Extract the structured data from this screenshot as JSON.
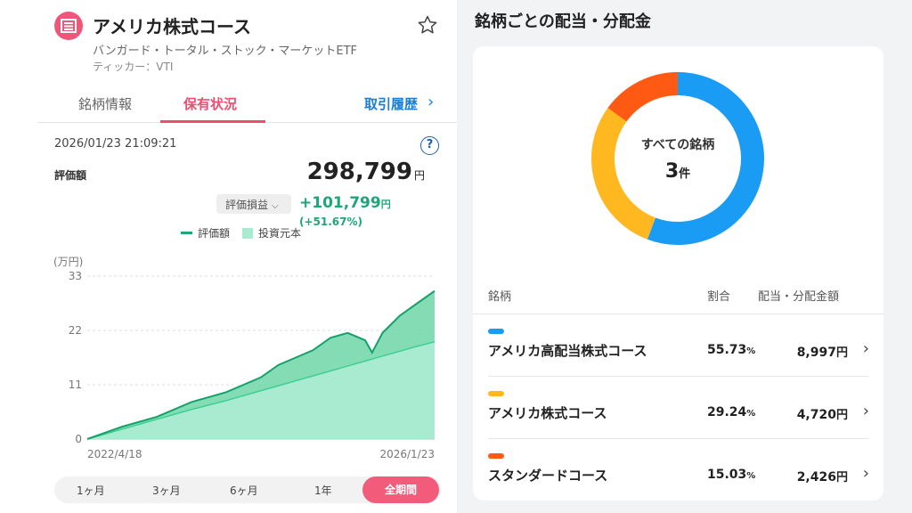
{
  "header": {
    "title": "アメリカ株式コース",
    "subtitle": "バンガード・トータル・ストック・マーケットETF",
    "ticker": "ティッカー：VTI"
  },
  "tabs": [
    {
      "label": "銘柄情報"
    },
    {
      "label": "保有状況",
      "active": true
    },
    {
      "label": "取引履歴"
    }
  ],
  "summary": {
    "datetime": "2026/01/23 21:09:21",
    "valuation_label": "評価額",
    "valuation_value": "298,799",
    "yen": "円",
    "pl_dropdown_label": "評価損益",
    "pl_value": "+101,799",
    "pl_pct": "(+51.67%)"
  },
  "chart_data": {
    "type": "area",
    "unit_label": "(万円)",
    "series": [
      {
        "name": "評価額",
        "color": "#1ea776"
      },
      {
        "name": "投資元本",
        "color": "#a9ebd0"
      }
    ],
    "ylim": [
      0,
      33
    ],
    "yticks": [
      "0",
      "11",
      "22",
      "33"
    ],
    "x_start_label": "2022/4/18",
    "x_end_label": "2026/1/23",
    "x": [
      0,
      0.1,
      0.2,
      0.3,
      0.4,
      0.5,
      0.55,
      0.6,
      0.65,
      0.7,
      0.75,
      0.8,
      0.82,
      0.85,
      0.9,
      0.95,
      1.0
    ],
    "valuation": [
      0,
      2.5,
      4.5,
      7.5,
      9.5,
      12.5,
      15,
      16.5,
      18,
      20.5,
      21.5,
      20,
      17.5,
      21.5,
      25,
      27.5,
      30.0
    ],
    "principal": [
      0,
      2,
      4,
      6,
      7.8,
      9.8,
      10.8,
      11.8,
      12.8,
      13.8,
      14.8,
      15.8,
      16.2,
      16.8,
      17.8,
      18.8,
      19.7
    ]
  },
  "periods": [
    {
      "label": "1ヶ月"
    },
    {
      "label": "3ヶ月"
    },
    {
      "label": "6ヶ月"
    },
    {
      "label": "1年"
    },
    {
      "label": "全期間",
      "active": true
    }
  ],
  "dividends": {
    "title": "銘柄ごとの配当・分配金",
    "donut_label": "すべての銘柄",
    "count": "3",
    "count_unit": "件",
    "columns": {
      "name": "銘柄",
      "ratio": "割合",
      "amount": "配当・分配金額"
    },
    "percent_unit": "%",
    "yen_unit": "円",
    "items": [
      {
        "name": "アメリカ高配当株式コース",
        "ratio": "55.73",
        "amount": "8,997",
        "color": "#1a9cf5"
      },
      {
        "name": "アメリカ株式コース",
        "ratio": "29.24",
        "amount": "4,720",
        "color": "#ffb81f"
      },
      {
        "name": "スタンダードコース",
        "ratio": "15.03",
        "amount": "2,426",
        "color": "#ff5a14"
      }
    ]
  }
}
